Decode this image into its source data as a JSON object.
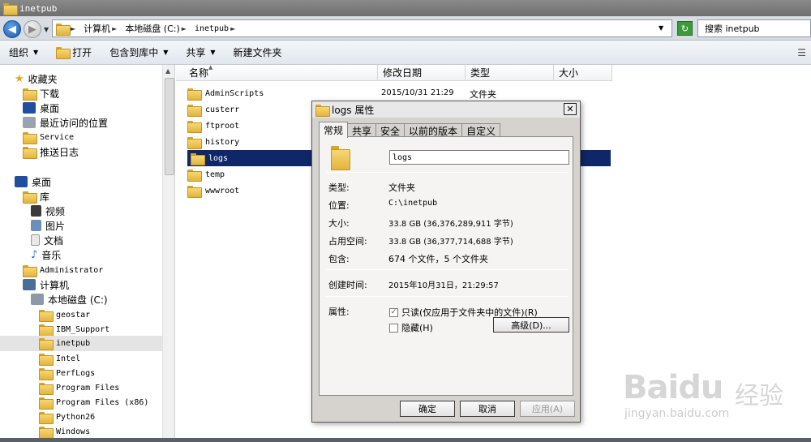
{
  "window": {
    "title": "inetpub"
  },
  "address": {
    "crumbs": [
      "计算机",
      "本地磁盘 (C:)",
      "inetpub"
    ],
    "search_placeholder": "搜索 inetpub"
  },
  "toolbar": {
    "organize": "组织",
    "open": "打开",
    "include_in_library": "包含到库中",
    "share": "共享",
    "new_folder": "新建文件夹"
  },
  "nav": {
    "favorites": "收藏夹",
    "favorites_items": [
      "下载",
      "桌面",
      "最近访问的位置",
      "Service",
      "推送日志"
    ],
    "desktop": "桌面",
    "libraries": "库",
    "library_items": [
      "视频",
      "图片",
      "文档",
      "音乐"
    ],
    "administrator": "Administrator",
    "computer": "计算机",
    "local_disk": "本地磁盘 (C:)",
    "disk_items": [
      "geostar",
      "IBM_Support",
      "inetpub",
      "Intel",
      "PerfLogs",
      "Program Files",
      "Program Files (x86)",
      "Python26",
      "Windows"
    ]
  },
  "columns": {
    "name": "名称",
    "date": "修改日期",
    "type": "类型",
    "size": "大小"
  },
  "files": [
    {
      "name": "AdminScripts",
      "date": "2015/10/31 21:29",
      "type": "文件夹"
    },
    {
      "name": "custerr"
    },
    {
      "name": "ftproot"
    },
    {
      "name": "history"
    },
    {
      "name": "logs"
    },
    {
      "name": "temp"
    },
    {
      "name": "wwwroot"
    }
  ],
  "dialog": {
    "title": "logs 属性",
    "tabs": [
      "常规",
      "共享",
      "安全",
      "以前的版本",
      "自定义"
    ],
    "folder_name": "logs",
    "labels": {
      "type": "类型:",
      "location": "位置:",
      "size": "大小:",
      "size_on_disk": "占用空间:",
      "contains": "包含:",
      "created": "创建时间:",
      "attributes": "属性:"
    },
    "values": {
      "type": "文件夹",
      "location": "C:\\inetpub",
      "size": "33.8 GB (36,376,289,911 字节)",
      "size_on_disk": "33.8 GB (36,377,714,688 字节)",
      "contains": "674 个文件，5 个文件夹",
      "created": "2015年10月31日，21:29:57"
    },
    "readonly_label": "只读(仅应用于文件夹中的文件)(R)",
    "hidden_label": "隐藏(H)",
    "advanced_button": "高级(D)...",
    "ok_button": "确定",
    "cancel_button": "取消",
    "apply_button": "应用(A)"
  },
  "watermark": {
    "logo": "Baidu",
    "logo2": "经验",
    "url": "jingyan.baidu.com"
  }
}
